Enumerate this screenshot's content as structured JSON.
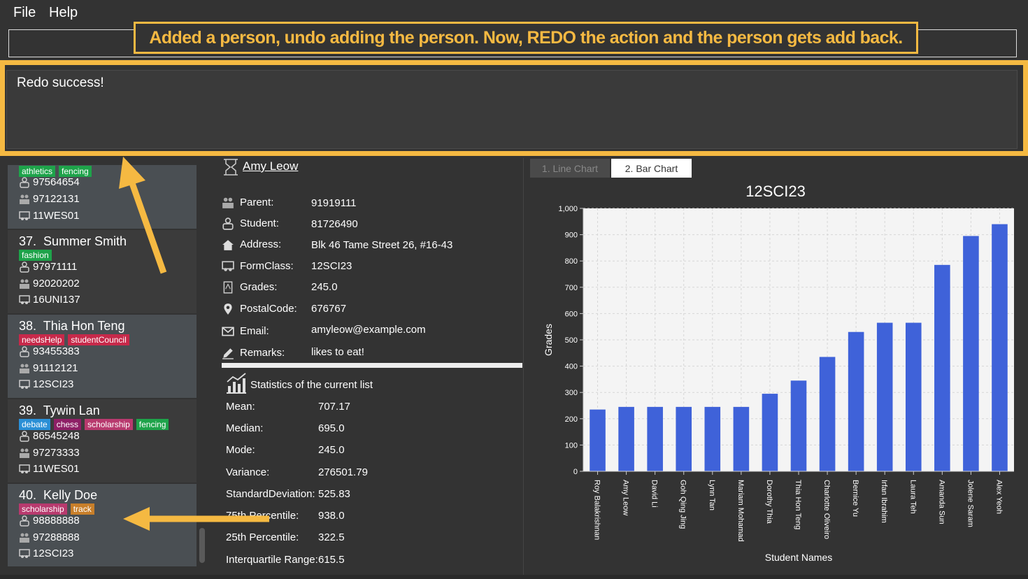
{
  "menu": {
    "file": "File",
    "help": "Help"
  },
  "annotation": {
    "banner": "Added a person, undo adding the person. Now, REDO the action and the person gets add back."
  },
  "result": {
    "text": "Redo success!"
  },
  "people": [
    {
      "index": "",
      "name": "",
      "tags": [
        {
          "label": "athletics",
          "color": "#1ea34a"
        },
        {
          "label": "fencing",
          "color": "#1ea34a"
        }
      ],
      "student": "97564654",
      "parent": "97122131",
      "formclass": "11WES01"
    },
    {
      "index": "37.",
      "name": "Summer Smith",
      "tags": [
        {
          "label": "fashion",
          "color": "#1ea34a"
        }
      ],
      "student": "97971111",
      "parent": "92020202",
      "formclass": "16UNI137"
    },
    {
      "index": "38.",
      "name": "Thia Hon Teng",
      "tags": [
        {
          "label": "needsHelp",
          "color": "#c7294a"
        },
        {
          "label": "studentCouncil",
          "color": "#c7294a"
        }
      ],
      "student": "93455383",
      "parent": "91112121",
      "formclass": "12SCI23"
    },
    {
      "index": "39.",
      "name": "Tywin Lan",
      "tags": [
        {
          "label": "debate",
          "color": "#2a8fd6"
        },
        {
          "label": "chess",
          "color": "#8e1f66"
        },
        {
          "label": "scholarship",
          "color": "#b83a6e"
        },
        {
          "label": "fencing",
          "color": "#1ea34a"
        }
      ],
      "student": "86545248",
      "parent": "97273333",
      "formclass": "11WES01"
    },
    {
      "index": "40.",
      "name": "Kelly Doe",
      "tags": [
        {
          "label": "scholarship",
          "color": "#b83a6e"
        },
        {
          "label": "track",
          "color": "#c87f2a"
        }
      ],
      "student": "98888888",
      "parent": "97288888",
      "formclass": "12SCI23"
    }
  ],
  "detail": {
    "name": "Amy Leow",
    "rows": [
      {
        "label": "Parent:",
        "value": "91919111",
        "icon": "parent-icon"
      },
      {
        "label": "Student:",
        "value": "81726490",
        "icon": "student-icon"
      },
      {
        "label": "Address:",
        "value": "Blk 46 Tame Street 26, #16-43",
        "icon": "home-icon"
      },
      {
        "label": "FormClass:",
        "value": "12SCI23",
        "icon": "class-icon"
      },
      {
        "label": "Grades:",
        "value": "245.0",
        "icon": "grades-icon"
      },
      {
        "label": "PostalCode:",
        "value": "676767",
        "icon": "location-pin-icon"
      },
      {
        "label": "Email:",
        "value": "amyleow@example.com",
        "icon": "email-icon"
      },
      {
        "label": "Remarks:",
        "value": "likes to eat!",
        "icon": "pencil-icon"
      }
    ]
  },
  "stats": {
    "heading": "Statistics of the current list",
    "rows": [
      {
        "label": "Mean:",
        "value": "707.17"
      },
      {
        "label": "Median:",
        "value": "695.0"
      },
      {
        "label": "Mode:",
        "value": "245.0"
      },
      {
        "label": "Variance:",
        "value": "276501.79"
      },
      {
        "label": "StandardDeviation:",
        "value": "525.83"
      },
      {
        "label": "75th Percentile:",
        "value": "938.0"
      },
      {
        "label": "25th Percentile:",
        "value": "322.5"
      },
      {
        "label": "Interquartile Range:",
        "value": "615.5"
      }
    ]
  },
  "tabs": {
    "line": "1. Line Chart",
    "bar": "2. Bar Chart"
  },
  "colors": {
    "accent": "#f5b942",
    "bar": "#3f62d9"
  },
  "chart_data": {
    "type": "bar",
    "title": "12SCI23",
    "xlabel": "Student Names",
    "ylabel": "Grades",
    "ylim": [
      0,
      1000
    ],
    "yticks": [
      "0",
      "100",
      "200",
      "300",
      "400",
      "500",
      "600",
      "700",
      "800",
      "900",
      "1,000"
    ],
    "grid": true,
    "categories": [
      "Roy Balakrishnan",
      "Amy Leow",
      "David Li",
      "Goh Qing Jing",
      "Lynn Tan",
      "Mariam Mohamad",
      "Dorothy Thia",
      "Thia Hon Teng",
      "Charlotte Oliveiro",
      "Bernice Yu",
      "Irfan Ibrahim",
      "Laura Teh",
      "Amanda Sun",
      "Jolene Saram",
      "Alex Yeoh"
    ],
    "values": [
      235,
      245,
      245,
      245,
      245,
      245,
      295,
      345,
      435,
      530,
      565,
      565,
      785,
      895,
      940
    ]
  }
}
